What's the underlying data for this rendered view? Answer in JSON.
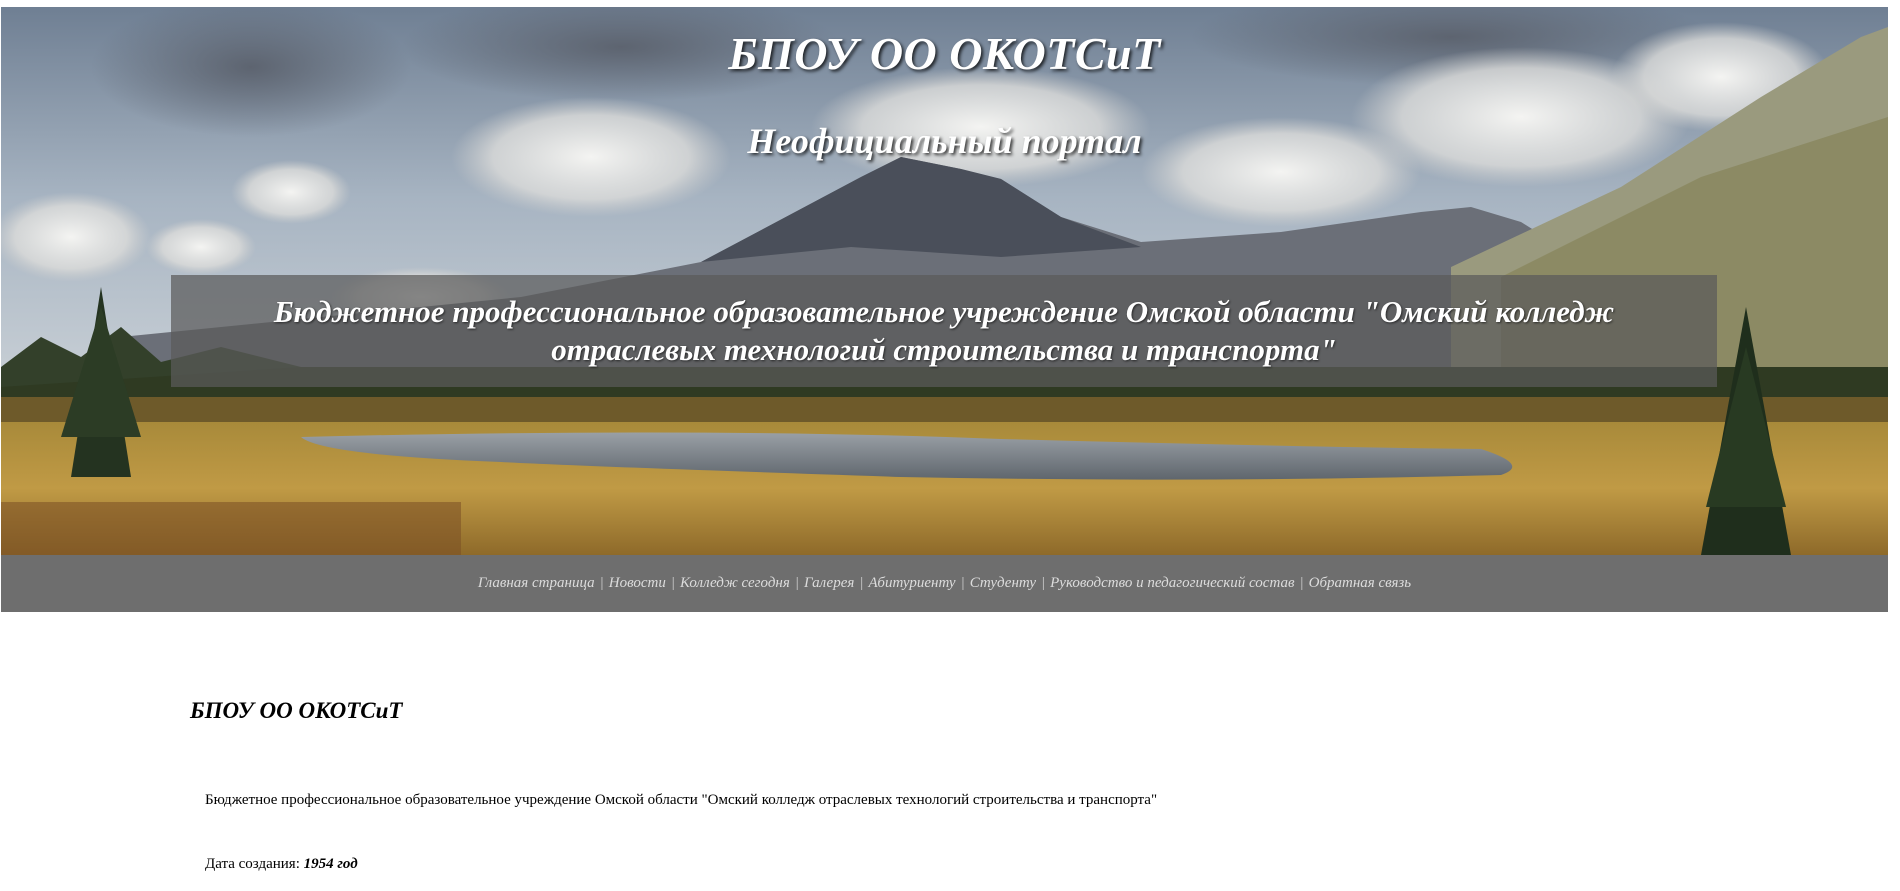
{
  "header": {
    "site_title": "БПОУ ОО ОКОТСиТ",
    "site_subtitle": "Неофициальный портал",
    "banner_text": "Бюджетное профессиональное образовательное учреждение Омской области \"Омский колледж отраслевых технологий строительства и транспорта\""
  },
  "nav": {
    "separator": "|",
    "items": [
      {
        "label": "Главная страница"
      },
      {
        "label": "Новости"
      },
      {
        "label": "Колледж сегодня"
      },
      {
        "label": "Галерея"
      },
      {
        "label": "Абитуриенту"
      },
      {
        "label": "Студенту"
      },
      {
        "label": "Руководство и педагогический состав"
      },
      {
        "label": "Обратная связь"
      }
    ]
  },
  "main": {
    "title": "БПОУ ОО ОКОТСиТ",
    "description": "Бюджетное профессиональное образовательное учреждение Омской области \"Омский колледж отраслевых технологий строительства и транспорта\"",
    "founded_label": "Дата создания:",
    "founded_value": "1954 год"
  },
  "colors": {
    "nav_background": "#6e6e6e",
    "nav_text": "#dcdcdc",
    "banner_background": "#5a5a5a",
    "header_text": "#ffffff"
  }
}
